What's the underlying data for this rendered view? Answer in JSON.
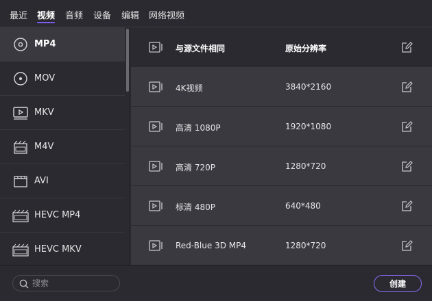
{
  "tabs": [
    {
      "label": "最近"
    },
    {
      "label": "视频"
    },
    {
      "label": "音频"
    },
    {
      "label": "设备"
    },
    {
      "label": "编辑"
    },
    {
      "label": "网络视频"
    }
  ],
  "active_tab": "视频",
  "sidebar": {
    "items": [
      {
        "label": "MP4",
        "icon": "disc-icon"
      },
      {
        "label": "MOV",
        "icon": "disc-icon"
      },
      {
        "label": "MKV",
        "icon": "video-file-icon"
      },
      {
        "label": "M4V",
        "icon": "m4v-file-icon"
      },
      {
        "label": "AVI",
        "icon": "clapper-icon"
      },
      {
        "label": "HEVC MP4",
        "icon": "hevc-icon"
      },
      {
        "label": "HEVC MKV",
        "icon": "hevc-icon"
      }
    ]
  },
  "presets": [
    {
      "name": "与源文件相同",
      "resolution": "原始分辨率"
    },
    {
      "name": "4K视频",
      "resolution": "3840*2160"
    },
    {
      "name": "高清 1080P",
      "resolution": "1920*1080"
    },
    {
      "name": "高清 720P",
      "resolution": "1280*720"
    },
    {
      "name": "标清 480P",
      "resolution": "640*480"
    },
    {
      "name": "Red-Blue 3D MP4",
      "resolution": "1280*720"
    }
  ],
  "search": {
    "placeholder": "搜索"
  },
  "create_button": {
    "label": "创建"
  },
  "colors": {
    "accent": "#7c5cf0",
    "background": "#2b2a30",
    "panel": "#3a3940"
  }
}
